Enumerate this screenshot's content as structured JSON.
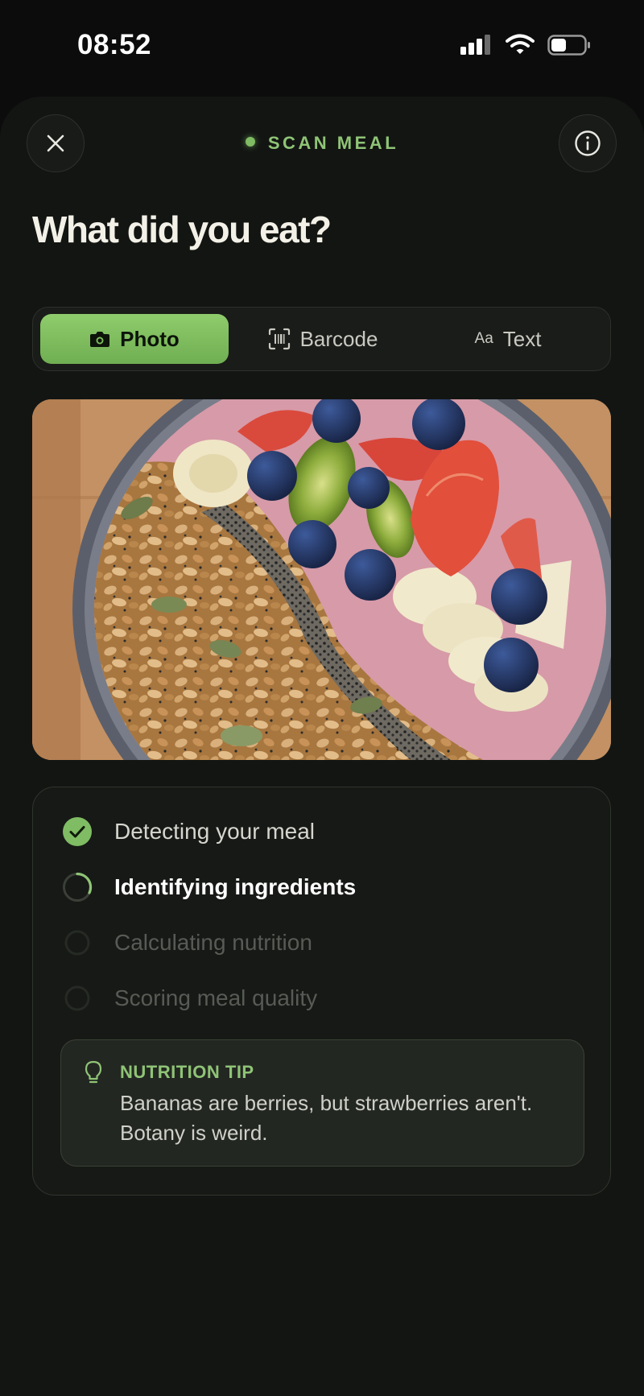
{
  "status_bar": {
    "time": "08:52"
  },
  "header": {
    "badge": "SCAN MEAL",
    "title": "What did you eat?"
  },
  "modes": [
    {
      "label": "Photo",
      "icon": "camera-icon",
      "active": true
    },
    {
      "label": "Barcode",
      "icon": "barcode-scan-icon",
      "active": false
    },
    {
      "label": "Text",
      "icon": "Aa",
      "active": false
    }
  ],
  "analysis": {
    "steps": [
      {
        "label": "Detecting your meal",
        "state": "done"
      },
      {
        "label": "Identifying ingredients",
        "state": "in-progress"
      },
      {
        "label": "Calculating nutrition",
        "state": "pending"
      },
      {
        "label": "Scoring meal quality",
        "state": "pending"
      }
    ],
    "tip": {
      "heading": "NUTRITION TIP",
      "body": "Bananas are berries, but strawberries aren't. Botany is weird."
    }
  },
  "colors": {
    "accent": "#8fc476",
    "background": "#0b0c0b",
    "sheet": "#131513"
  }
}
